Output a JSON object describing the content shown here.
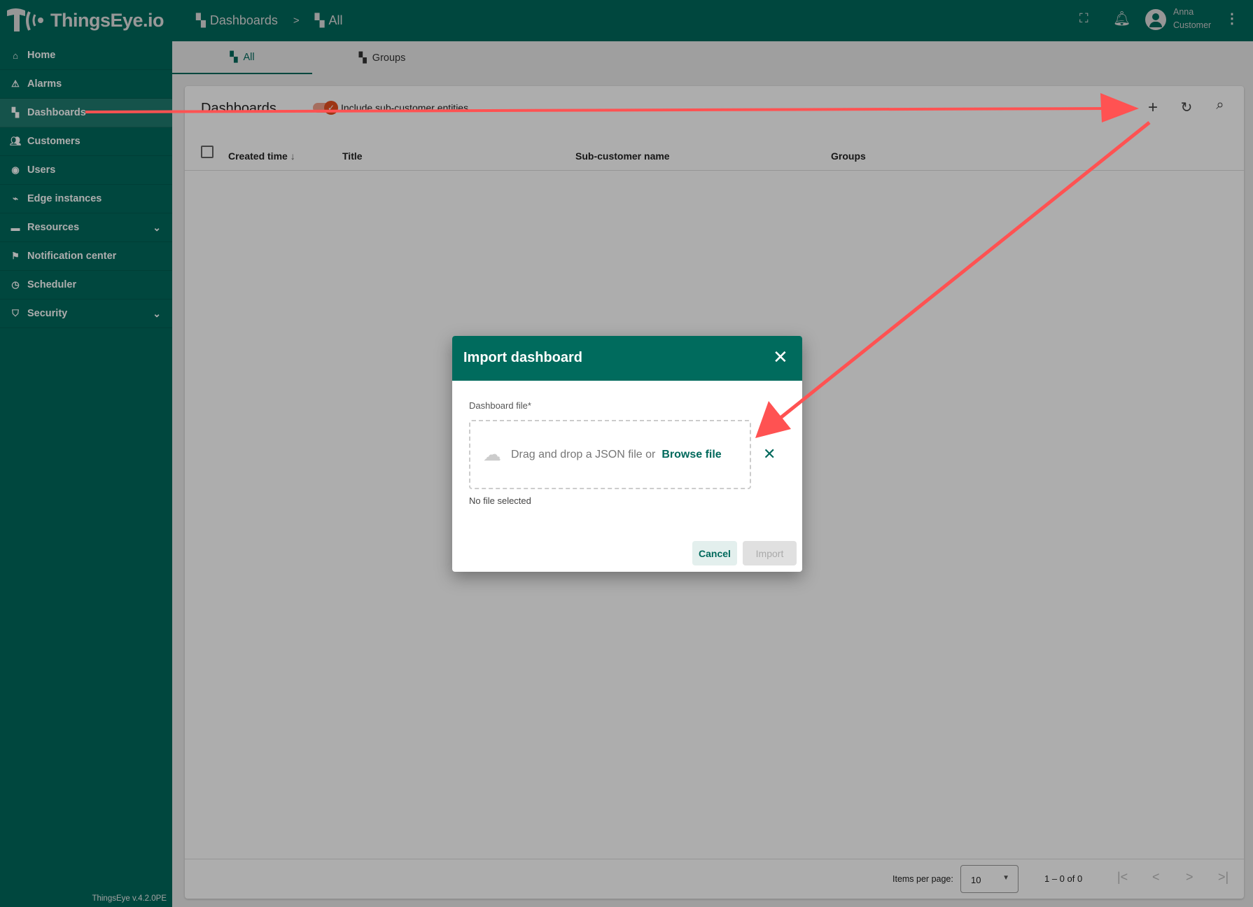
{
  "header": {
    "logo": "ThingsEye.io",
    "breadcrumb": [
      "Dashboards",
      "All"
    ],
    "breadcrumb_separator": ">",
    "user_name": "Anna",
    "user_role": "Customer",
    "icons": [
      "fullscreen-icon",
      "bell-icon",
      "account-icon",
      "more-vert-icon"
    ]
  },
  "sidebar": {
    "items": [
      {
        "label": "Home",
        "icon": "home-icon"
      },
      {
        "label": "Alarms",
        "icon": "warning-icon"
      },
      {
        "label": "Dashboards",
        "icon": "dashboard-icon",
        "active": true
      },
      {
        "label": "Customers",
        "icon": "people-icon"
      },
      {
        "label": "Users",
        "icon": "user-icon"
      },
      {
        "label": "Edge instances",
        "icon": "router-icon"
      },
      {
        "label": "Resources",
        "icon": "folder-icon",
        "expandable": true
      },
      {
        "label": "Notification center",
        "icon": "notification-icon"
      },
      {
        "label": "Scheduler",
        "icon": "clock-icon"
      },
      {
        "label": "Security",
        "icon": "shield-icon",
        "expandable": true
      }
    ],
    "version": "ThingsEye v.4.2.0PE"
  },
  "tabs": [
    {
      "label": "All",
      "active": true
    },
    {
      "label": "Groups"
    }
  ],
  "card": {
    "title": "Dashboards",
    "toggle_label": "Include sub-customer entities",
    "columns": [
      "Created time",
      "Title",
      "Sub-customer name",
      "Groups"
    ],
    "sort_indicator": "↓",
    "footer": {
      "items_per_page_label": "Items per page:",
      "items_per_page": "10",
      "range": "1 – 0 of 0"
    }
  },
  "dialog": {
    "title": "Import dashboard",
    "field_label": "Dashboard file*",
    "drop_text": "Drag and drop a JSON file or",
    "browse_label": "Browse file",
    "status": "No file selected",
    "cancel_label": "Cancel",
    "import_label": "Import"
  },
  "colors": {
    "primary": "#00695c",
    "annotation": "#ff5252"
  }
}
